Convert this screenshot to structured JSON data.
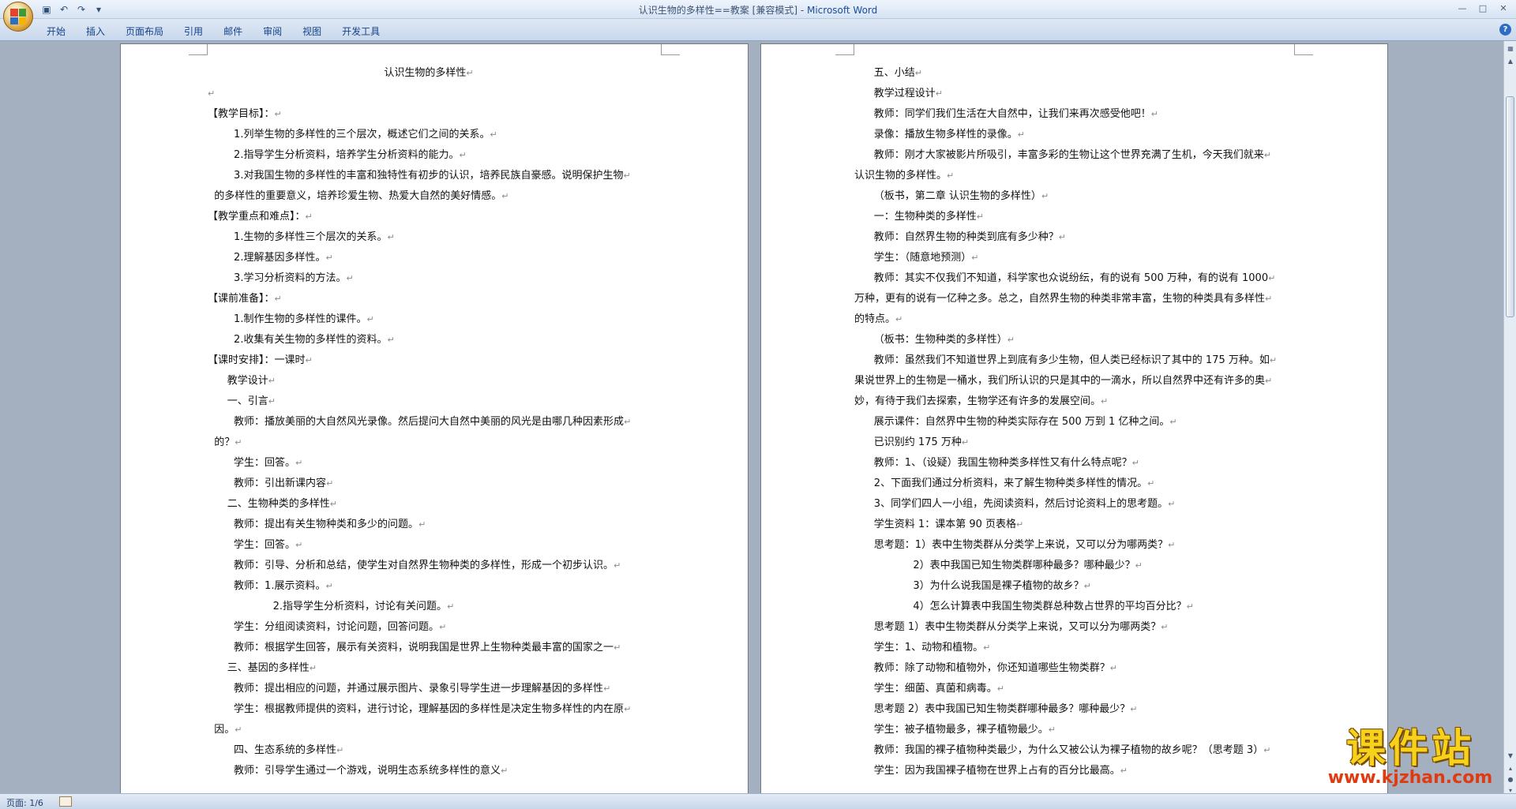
{
  "window": {
    "title": "认识生物的多样性==教案 [兼容模式] - ",
    "app_name": "Microsoft Word",
    "controls": [
      "—",
      "□",
      "✕"
    ]
  },
  "ribbon": {
    "tabs": [
      "开始",
      "插入",
      "页面布局",
      "引用",
      "邮件",
      "审阅",
      "视图",
      "开发工具"
    ],
    "help": "?"
  },
  "document": {
    "left_page_lines": [
      "认识生物的多样性",
      "",
      "【教学目标】：",
      "        1.列举生物的多样性的三个层次，概述它们之间的关系。",
      "        2.指导学生分析资料，培养学生分析资料的能力。",
      "        3.对我国生物的多样性的丰富和独特性有初步的认识，培养民族自豪感。说明保护生物",
      "  的多样性的重要意义，培养珍爱生物、热爱大自然的美好情感。",
      "【教学重点和难点】：",
      "        1.生物的多样性三个层次的关系。",
      "        2.理解基因多样性。",
      "        3.学习分析资料的方法。",
      "【课前准备】：",
      "        1.制作生物的多样性的课件。",
      "        2.收集有关生物的多样性的资料。",
      "【课时安排】：一课时",
      "      教学设计",
      "      一、引言",
      "        教师：播放美丽的大自然风光录像。然后提问大自然中美丽的风光是由哪几种因素形成",
      "  的？",
      "        学生：回答。",
      "        教师：引出新课内容",
      "      二、生物种类的多样性",
      "        教师：提出有关生物种类和多少的问题。",
      "        学生：回答。",
      "        教师：引导、分析和总结，使学生对自然界生物种类的多样性，形成一个初步认识。",
      "        教师：1.展示资料。",
      "                    2.指导学生分析资料，讨论有关问题。",
      "        学生：分组阅读资料，讨论问题，回答问题。",
      "        教师：根据学生回答，展示有关资料，说明我国是世界上生物种类最丰富的国家之一",
      "      三、基因的多样性",
      "        教师：提出相应的问题，并通过展示图片、录象引导学生进一步理解基因的多样性",
      "        学生：根据教师提供的资料，进行讨论，理解基因的多样性是决定生物多样性的内在原",
      "  因。",
      "        四、生态系统的多样性",
      "        教师：引导学生通过一个游戏，说明生态系统多样性的意义"
    ],
    "right_page_lines": [
      "      五、小结",
      "      教学过程设计",
      "      教师：同学们我们生活在大自然中，让我们来再次感受他吧！",
      "      录像：播放生物多样性的录像。",
      "      教师：刚才大家被影片所吸引，丰富多彩的生物让这个世界充满了生机，今天我们就来",
      "认识生物的多样性。",
      "      （板书，第二章 认识生物的多样性）",
      "      一：生物种类的多样性",
      "      教师：自然界生物的种类到底有多少种？",
      "      学生：（随意地预测）",
      "      教师：其实不仅我们不知道，科学家也众说纷纭，有的说有 500 万种，有的说有 1000",
      "万种，更有的说有一亿种之多。总之，自然界生物的种类非常丰富，生物的种类具有多样性",
      "的特点。",
      "      （板书：生物种类的多样性）",
      "      教师：虽然我们不知道世界上到底有多少生物，但人类已经标识了其中的 175 万种。如",
      "果说世界上的生物是一桶水，我们所认识的只是其中的一滴水，所以自然界中还有许多的奥",
      "妙，有待于我们去探索，生物学还有许多的发展空间。",
      "      展示课件：自然界中生物的种类实际存在 500 万到 1 亿种之间。",
      "      已识别约 175 万种",
      "      教师：1、（设疑）我国生物种类多样性又有什么特点呢？",
      "      2、下面我们通过分析资料，来了解生物种类多样性的情况。",
      "      3、同学们四人一小组，先阅读资料，然后讨论资料上的思考题。",
      "      学生资料 1：课本第 90 页表格",
      "      思考题：1）表中生物类群从分类学上来说，又可以分为哪两类？",
      "                  2）表中我国已知生物类群哪种最多？哪种最少？",
      "                  3）为什么说我国是裸子植物的故乡？",
      "                  4）怎么计算表中我国生物类群总种数占世界的平均百分比？",
      "      思考题 1）表中生物类群从分类学上来说，又可以分为哪两类？",
      "      学生：1、动物和植物。",
      "      教师：除了动物和植物外，你还知道哪些生物类群？",
      "      学生：细菌、真菌和病毒。",
      "      思考题 2）表中我国已知生物类群哪种最多？哪种最少？",
      "      学生：被子植物最多，裸子植物最少。",
      "      教师：我国的裸子植物种类最少，为什么又被公认为裸子植物的故乡呢？（思考题 3）",
      "      学生：因为我国裸子植物在世界上占有的百分比最高。"
    ]
  },
  "status_bar": {
    "page_indicator": "页面: 1/6"
  },
  "watermark": {
    "text": "课件站",
    "url": "www.kjzhan.com"
  }
}
